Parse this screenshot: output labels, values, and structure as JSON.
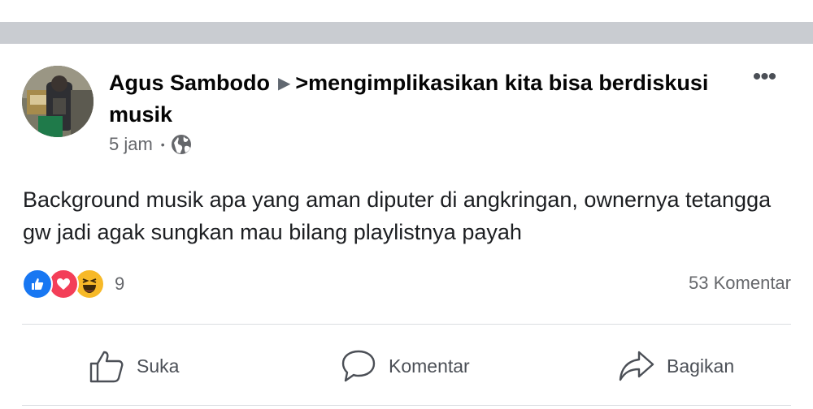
{
  "post": {
    "author": "Agus Sambodo",
    "arrow": "▶",
    "group": ">mengimplikasikan kita bisa berdiskusi musik",
    "more": "•••",
    "time": "5 jam",
    "meta_dot": "•",
    "privacy_icon": "globe-icon",
    "text": "Background musik apa yang aman diputer di angkringan, ownernya tetangga gw jadi agak sungkan mau bilang playlistnya payah",
    "reactions": {
      "icons": [
        "like-reaction-icon",
        "love-reaction-icon",
        "haha-reaction-icon"
      ],
      "count": "9"
    },
    "comments": "53 Komentar"
  },
  "actions": {
    "like": "Suka",
    "comment": "Komentar",
    "share": "Bagikan"
  },
  "colors": {
    "separator": "#c9ccd1",
    "like_blue": "#1877f2",
    "love_red": "#f33e58",
    "haha_yellow": "#f7b928",
    "secondary_text": "#65676b"
  }
}
